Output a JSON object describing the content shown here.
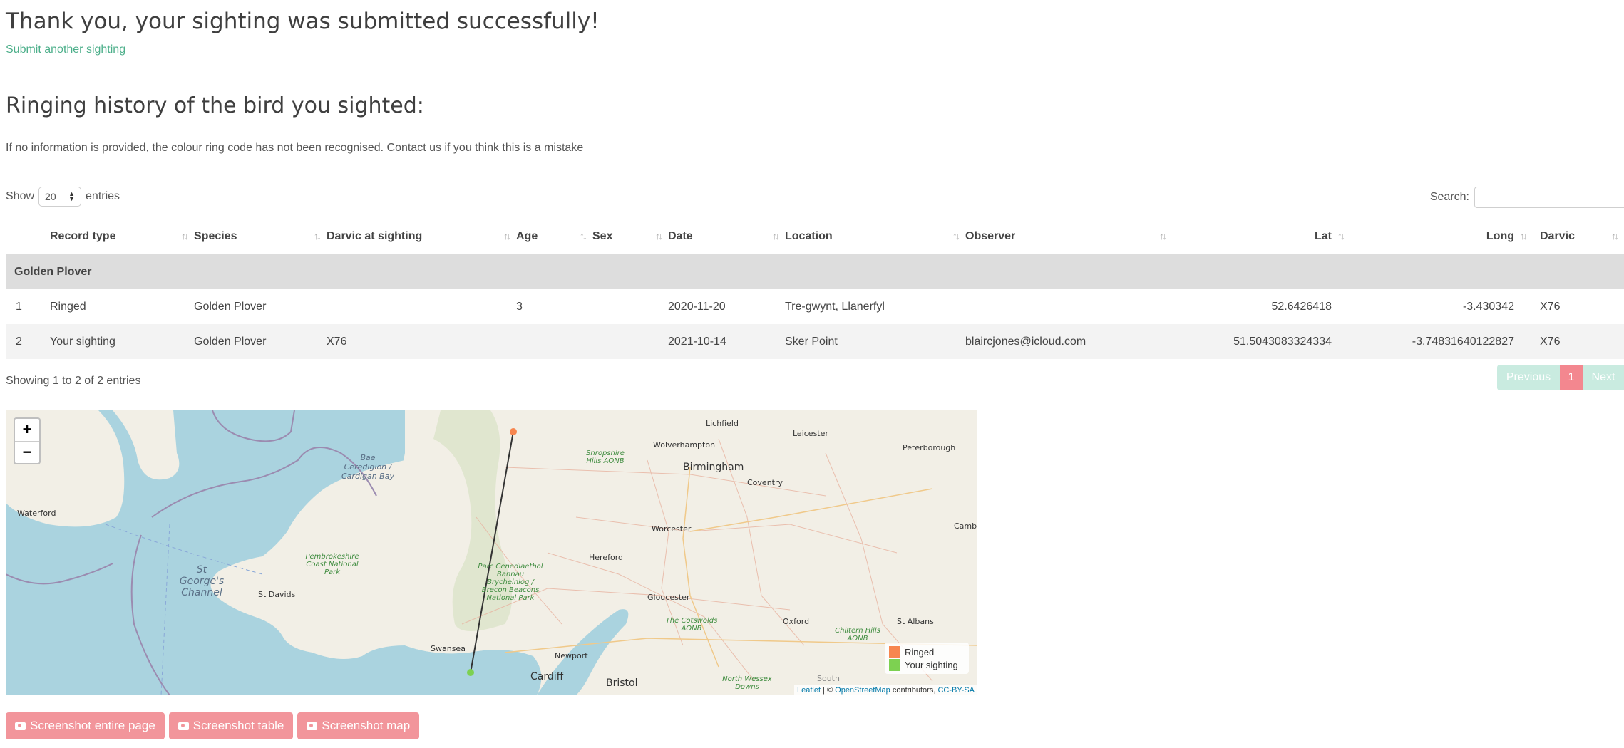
{
  "header": {
    "success_title": "Thank you, your sighting was submitted successfully!",
    "another_link": "Submit another sighting",
    "history_title": "Ringing history of the bird you sighted:",
    "notice": "If no information is provided, the colour ring code has not been recognised. Contact us if you think this is a mistake"
  },
  "table_controls": {
    "show_label": "Show",
    "entries_value": "20",
    "entries_label": "entries",
    "search_label": "Search:",
    "info": "Showing 1 to 2 of 2 entries",
    "pager": {
      "previous": "Previous",
      "current": "1",
      "next": "Next"
    }
  },
  "table": {
    "columns": [
      "Record type",
      "Species",
      "Darvic at sighting",
      "Age",
      "Sex",
      "Date",
      "Location",
      "Observer",
      "Lat",
      "Long",
      "Darvic"
    ],
    "group": "Golden Plover",
    "rows": [
      {
        "idx": "1",
        "record_type": "Ringed",
        "species": "Golden Plover",
        "darvic_at_sighting": "",
        "age": "3",
        "sex": "",
        "date": "2020-11-20",
        "location": "Tre-gwynt, Llanerfyl",
        "observer": "",
        "lat": "52.6426418",
        "long": "-3.430342",
        "darvic": "X76"
      },
      {
        "idx": "2",
        "record_type": "Your sighting",
        "species": "Golden Plover",
        "darvic_at_sighting": "X76",
        "age": "",
        "sex": "",
        "date": "2021-10-14",
        "location": "Sker Point",
        "observer": "blaircjones@icloud.com",
        "lat": "51.5043083324334",
        "long": "-3.74831640122827",
        "darvic": "X76"
      }
    ]
  },
  "map": {
    "zoom_in": "+",
    "zoom_out": "−",
    "legend": [
      {
        "label": "Ringed",
        "color": "#f7864f"
      },
      {
        "label": "Your sighting",
        "color": "#7dd151"
      }
    ],
    "attribution": {
      "leaflet": "Leaflet",
      "sep1": " | © ",
      "osm": "OpenStreetMap",
      "contrib": " contributors, ",
      "license": "CC-BY-SA"
    },
    "labels": {
      "waterford": "Waterford",
      "cardigan_bay": "Bae Ceredigion / Cardigan Bay",
      "st_georges": "St George's Channel",
      "pembrokeshire": "Pembrokeshire Coast National Park",
      "st_davids": "St Davids",
      "brecon": "Parc Cenedlaethol Bannau Brycheiniog / Brecon Beacons National Park",
      "swansea": "Swansea",
      "cardiff": "Cardiff",
      "newport": "Newport",
      "bristol": "Bristol",
      "hereford": "Hereford",
      "worcester": "Worcester",
      "gloucester": "Gloucester",
      "oxford": "Oxford",
      "cotswolds": "The Cotswolds AONB",
      "birmingham": "Birmingham",
      "wolverhampton": "Wolverhampton",
      "shropshire": "Shropshire Hills AONB",
      "lichfield": "Lichfield",
      "leicester": "Leicester",
      "coventry": "Coventry",
      "peterborough": "Peterborough",
      "cambr": "Cambr",
      "st_albans": "St Albans",
      "chiltern": "Chiltern Hills AONB",
      "north_wessex": "North Wessex Downs",
      "south": "South"
    },
    "colors": {
      "sea": "#aad3df",
      "land": "#f2efe6",
      "line": "#333333"
    }
  },
  "buttons": {
    "entire_page": "Screenshot entire page",
    "table": "Screenshot table",
    "map": "Screenshot map"
  }
}
